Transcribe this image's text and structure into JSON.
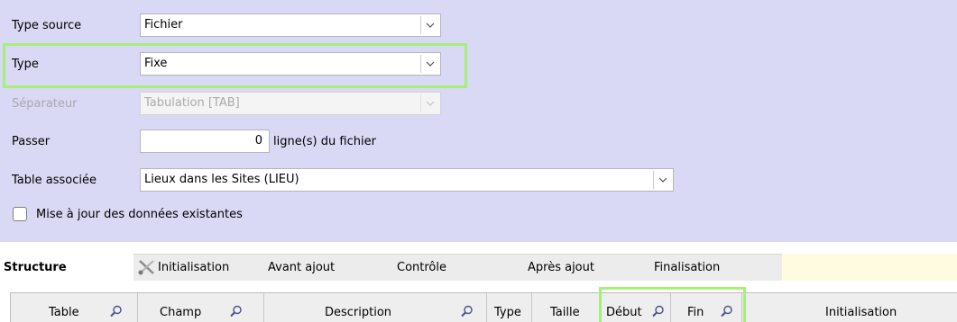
{
  "form": {
    "type_source": {
      "label": "Type source",
      "value": "Fichier"
    },
    "type": {
      "label": "Type",
      "value": "Fixe"
    },
    "separateur": {
      "label": "Séparateur",
      "value": "Tabulation [TAB]"
    },
    "passer": {
      "label": "Passer",
      "value": "0",
      "suffix": "ligne(s) du fichier"
    },
    "table_associee": {
      "label": "Table associée",
      "value": "Lieux dans les Sites (LIEU)"
    },
    "mise_a_jour": {
      "label": "Mise à jour des données existantes",
      "checked": false
    }
  },
  "tabs": [
    {
      "label": "Structure",
      "active": true
    },
    {
      "label": "Initialisation",
      "icon": "tools-icon"
    },
    {
      "label": "Avant ajout"
    },
    {
      "label": "Contrôle"
    },
    {
      "label": "Après ajout"
    },
    {
      "label": "Finalisation"
    }
  ],
  "grid": {
    "columns": [
      {
        "label": "Table",
        "searchable": true
      },
      {
        "label": "Champ",
        "searchable": true
      },
      {
        "label": "Description",
        "searchable": true
      },
      {
        "label": "Type",
        "searchable": false
      },
      {
        "label": "Taille",
        "searchable": false
      },
      {
        "label": "Début",
        "searchable": true
      },
      {
        "label": "Fin",
        "searchable": true
      },
      {
        "label": "Initialisation",
        "searchable": false
      }
    ]
  },
  "colors": {
    "panel_bg": "#d9d8f5",
    "highlight": "#a6ef78",
    "tab_fill": "#fffbe0",
    "header_bg": "#eeeeee"
  }
}
